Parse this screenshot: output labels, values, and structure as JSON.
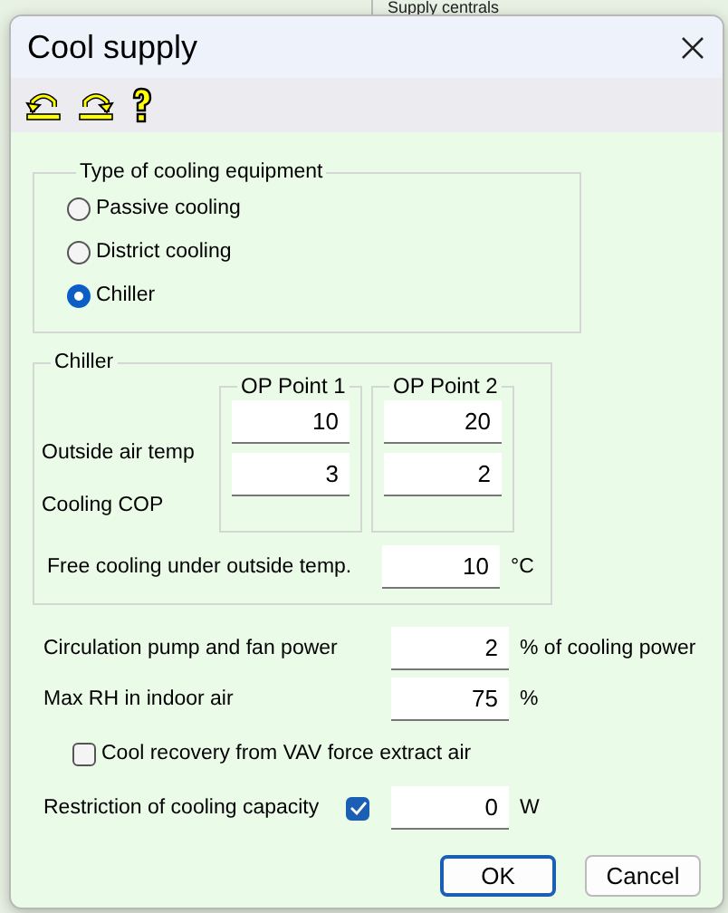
{
  "background_window": {
    "heading": "Supply centrals"
  },
  "dialog": {
    "title": "Cool supply"
  },
  "toolbar": [
    {
      "kind": "undo"
    },
    {
      "kind": "redo"
    },
    {
      "kind": "help"
    }
  ],
  "cooling_type": {
    "legend": "Type of cooling equipment",
    "options": [
      {
        "label": "Passive cooling",
        "selected": false
      },
      {
        "label": "District cooling",
        "selected": false
      },
      {
        "label": "Chiller",
        "selected": true
      }
    ]
  },
  "chiller": {
    "legend": "Chiller",
    "columns": [
      "OP Point 1",
      "OP Point 2"
    ],
    "rows": [
      {
        "label": "Outside air temp",
        "values": [
          "10",
          "20"
        ]
      },
      {
        "label": "Cooling COP",
        "values": [
          "3",
          "2"
        ]
      }
    ],
    "free_cooling": {
      "label": "Free cooling under outside temp.",
      "value": "10",
      "unit": "°C"
    }
  },
  "settings": [
    {
      "kind": "field",
      "label": "Circulation pump and fan power",
      "value": "2",
      "unit": "% of cooling power"
    },
    {
      "kind": "field",
      "label": "Max RH in indoor air",
      "value": "75",
      "unit": "%"
    },
    {
      "kind": "checkbox",
      "label": "Cool recovery from VAV force extract air",
      "checked": false
    },
    {
      "kind": "restriction",
      "label": "Restriction of cooling capacity",
      "checked": true,
      "value": "0",
      "unit": "W"
    }
  ],
  "buttons": [
    {
      "label": "OK",
      "default": true
    },
    {
      "label": "Cancel",
      "default": false
    }
  ]
}
